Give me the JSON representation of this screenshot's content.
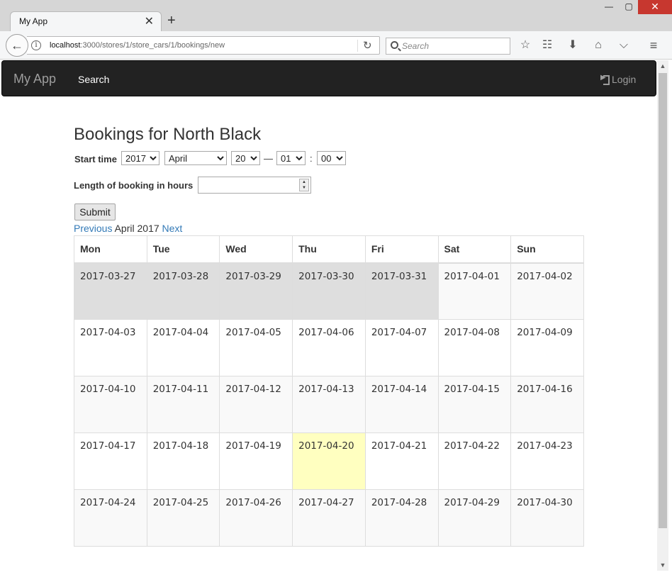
{
  "browser": {
    "tab_title": "My App",
    "tab_close": "✕",
    "new_tab": "+",
    "url_host": "localhost",
    "url_path": ":3000/stores/1/store_cars/1/bookings/new",
    "search_placeholder": "Search",
    "window_controls": {
      "minimize": "—",
      "maximize": "▢",
      "close": "✕"
    }
  },
  "app_nav": {
    "brand": "My App",
    "search": "Search",
    "login": "Login"
  },
  "form": {
    "title": "Bookings for North Black",
    "start_time_label": "Start time",
    "year": "2017",
    "month": "April",
    "day": "20",
    "dash": "—",
    "hour": "01",
    "colon": ":",
    "minute": "00",
    "length_label": "Length of booking in hours",
    "length_value": "",
    "submit_label": "Submit"
  },
  "calendar": {
    "prev_label": "Previous",
    "current_month": "April 2017",
    "next_label": "Next",
    "weekdays": [
      "Mon",
      "Tue",
      "Wed",
      "Thu",
      "Fri",
      "Sat",
      "Sun"
    ],
    "weeks": [
      [
        "2017-03-27",
        "2017-03-28",
        "2017-03-29",
        "2017-03-30",
        "2017-03-31",
        "2017-04-01",
        "2017-04-02"
      ],
      [
        "2017-04-03",
        "2017-04-04",
        "2017-04-05",
        "2017-04-06",
        "2017-04-07",
        "2017-04-08",
        "2017-04-09"
      ],
      [
        "2017-04-10",
        "2017-04-11",
        "2017-04-12",
        "2017-04-13",
        "2017-04-14",
        "2017-04-15",
        "2017-04-16"
      ],
      [
        "2017-04-17",
        "2017-04-18",
        "2017-04-19",
        "2017-04-20",
        "2017-04-21",
        "2017-04-22",
        "2017-04-23"
      ],
      [
        "2017-04-24",
        "2017-04-25",
        "2017-04-26",
        "2017-04-27",
        "2017-04-28",
        "2017-04-29",
        "2017-04-30"
      ]
    ],
    "today": "2017-04-20",
    "colors": {
      "prev_month": "#dedede",
      "today": "#ffffc0",
      "link": "#337ab7"
    }
  }
}
